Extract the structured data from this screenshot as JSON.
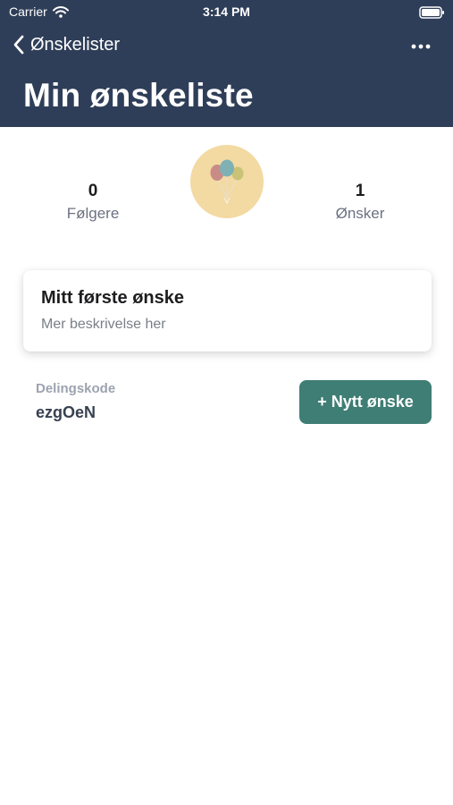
{
  "status_bar": {
    "carrier": "Carrier",
    "time": "3:14 PM",
    "wifi_icon": "wifi-icon",
    "battery_icon": "battery-icon"
  },
  "nav": {
    "back_label": "Ønskelister",
    "back_icon": "chevron-left-icon",
    "more_icon": "more-horizontal-icon",
    "title": "Min ønskeliste"
  },
  "stats": {
    "followers": {
      "value": "0",
      "label": "Følgere"
    },
    "wishes": {
      "value": "1",
      "label": "Ønsker"
    }
  },
  "avatar": {
    "icon": "balloons-icon",
    "background": "#f3d9a2"
  },
  "wish_list": [
    {
      "title": "Mitt første ønske",
      "description": "Mer beskrivelse her"
    }
  ],
  "share": {
    "label": "Delingskode",
    "code": "ezgOeN"
  },
  "actions": {
    "new_wish_label": "+ Nytt ønske"
  },
  "colors": {
    "header_bg": "#2f3e58",
    "accent": "#3f7e74"
  }
}
